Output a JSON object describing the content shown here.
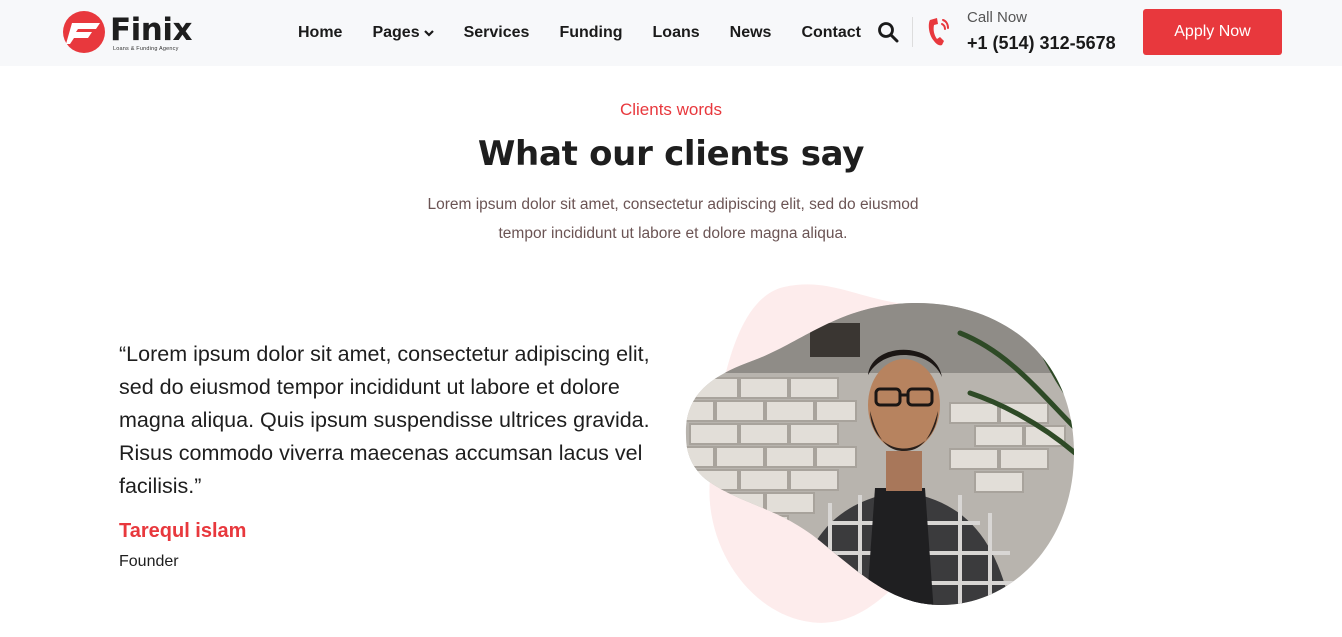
{
  "header": {
    "logo": {
      "name": "Finix",
      "tagline": "Loans & Funding Agency"
    },
    "nav": [
      {
        "label": "Home"
      },
      {
        "label": "Pages",
        "has_dropdown": true
      },
      {
        "label": "Services"
      },
      {
        "label": "Funding"
      },
      {
        "label": "Loans"
      },
      {
        "label": "News"
      },
      {
        "label": "Contact"
      }
    ],
    "call_label": "Call Now",
    "call_number": "+1 (514) 312-5678",
    "apply_label": "Apply Now"
  },
  "section": {
    "eyebrow": "Clients words",
    "title": "What our clients say",
    "intro_line1": "Lorem ipsum dolor sit amet, consectetur adipiscing elit, sed do eiusmod",
    "intro_line2": "tempor incididunt ut labore et dolore magna aliqua."
  },
  "testimonial": {
    "quote": "“Lorem ipsum dolor sit amet, consectetur adipiscing elit, sed do eiusmod tempor incididunt ut labore et dolore magna aliqua. Quis ipsum suspendisse ultrices gravida. Risus commodo viverra maecenas accumsan lacus vel facilisis.”",
    "author": "Tarequl islam",
    "role": "Founder"
  },
  "colors": {
    "accent": "#e8383d",
    "header_bg": "#f7f8fa",
    "blob_bg": "#fdecec",
    "text": "#1e1e1e"
  },
  "icons": [
    "finix-logo-icon",
    "chevron-down-icon",
    "search-icon",
    "phone-icon"
  ]
}
